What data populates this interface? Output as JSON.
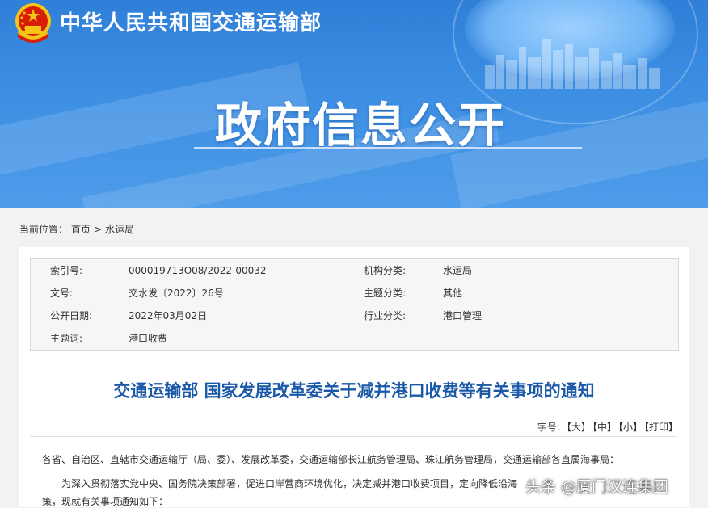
{
  "header": {
    "ministry_name": "中华人民共和国交通运输部",
    "section_title": "政府信息公开"
  },
  "breadcrumb": {
    "label": "当前位置：",
    "home": "首页",
    "separator": ">",
    "current": "水运局"
  },
  "meta": {
    "rows": [
      {
        "k1": "索引号:",
        "v1": "000019713O08/2022-00032",
        "k2": "机构分类:",
        "v2": "水运局"
      },
      {
        "k1": "文号:",
        "v1": "交水发〔2022〕26号",
        "k2": "主题分类:",
        "v2": "其他"
      },
      {
        "k1": "公开日期:",
        "v1": "2022年03月02日",
        "k2": "行业分类:",
        "v2": "港口管理"
      },
      {
        "k1": "主题词:",
        "v1": "港口收费",
        "k2": "",
        "v2": ""
      }
    ]
  },
  "document": {
    "title": "交通运输部 国家发展改革委关于减并港口收费等有关事项的通知",
    "font_size_label": "字号:",
    "font_large": "【大】",
    "font_medium": "【中】",
    "font_small": "【小】",
    "print": "【打印】",
    "salutation": "各省、自治区、直辖市交通运输厅（局、委）、发展改革委，交通运输部长江航务管理局、珠江航务管理局，交通运输部各直属海事局：",
    "paragraph1": "为深入贯彻落实党中央、国务院决策部署，促进口岸营商环境优化，决定减并港口收费项目，定向降低沿海",
    "paragraph1_cont": "策，现就有关事项通知如下："
  },
  "watermark": "头条 @厦门汉连集团",
  "colors": {
    "banner_blue": "#3d8fe3",
    "title_blue": "#1a58a8",
    "emblem_red": "#d81e06",
    "emblem_gold": "#f5c518"
  }
}
